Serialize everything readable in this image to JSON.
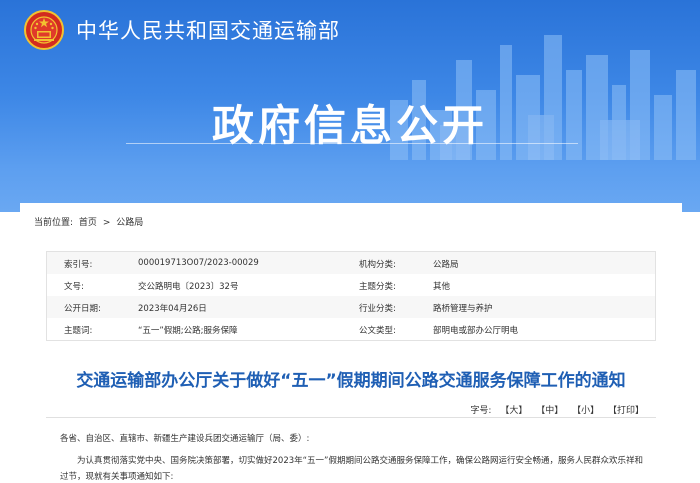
{
  "header": {
    "ministry_name": "中华人民共和国交通运输部",
    "banner_title": "政府信息公开",
    "emblem_icon": "national-emblem-icon"
  },
  "breadcrumb": {
    "label": "当前位置:",
    "home": "首页",
    "separator": ">",
    "current": "公路局"
  },
  "meta": {
    "rows": [
      {
        "k1": "索引号:",
        "v1": "000019713O07/2023-00029",
        "k2": "机构分类:",
        "v2": "公路局"
      },
      {
        "k1": "文号:",
        "v1": "交公路明电〔2023〕32号",
        "k2": "主题分类:",
        "v2": "其他"
      },
      {
        "k1": "公开日期:",
        "v1": "2023年04月26日",
        "k2": "行业分类:",
        "v2": "路桥管理与养护"
      },
      {
        "k1": "主题词:",
        "v1": "“五一”假期;公路;服务保障",
        "k2": "公文类型:",
        "v2": "部明电或部办公厅明电"
      }
    ]
  },
  "document": {
    "title": "交通运输部办公厅关于做好“五一”假期期间公路交通服务保障工作的通知",
    "font_size_label": "字号:",
    "font_size_options": [
      "【大】",
      "【中】",
      "【小】",
      "【打印】"
    ],
    "addressee": "各省、自治区、直辖市、新疆生产建设兵团交通运输厅（局、委）:",
    "body_para": "为认真贯彻落实党中央、国务院决策部署，切实做好2023年“五一”假期期间公路交通服务保障工作，确保公路网运行安全畅通，服务人民群众欢乐祥和过节，现就有关事项通知如下:"
  },
  "colors": {
    "banner_top": "#2a73d8",
    "banner_bottom": "#6aa8f2",
    "title_blue": "#1f5fb4"
  }
}
